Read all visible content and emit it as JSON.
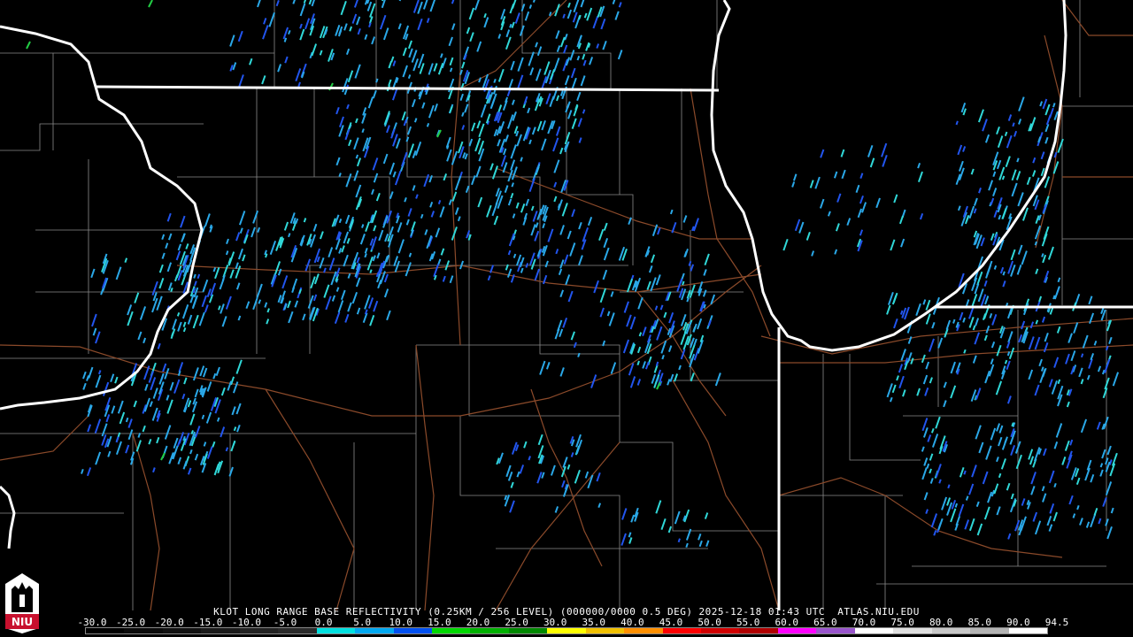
{
  "radar": {
    "station": "KLOT",
    "product": "LONG RANGE BASE REFLECTIVITY",
    "caption": "KLOT LONG RANGE BASE REFLECTIVITY (0.25KM / 256 LEVEL) (000000/0000 0.5 DEG) 2025-12-18 01:43 UTC  ATLAS.NIU.EDU"
  },
  "legend": {
    "labels": [
      "-30.0",
      "-25.0",
      "-20.0",
      "-15.0",
      "-10.0",
      "-5.0",
      "0.0",
      "5.0",
      "10.0",
      "15.0",
      "20.0",
      "25.0",
      "30.0",
      "35.0",
      "40.0",
      "45.0",
      "50.0",
      "55.0",
      "60.0",
      "65.0",
      "70.0",
      "75.0",
      "80.0",
      "85.0",
      "90.0",
      "94.5"
    ],
    "colors": [
      "#000000",
      "#0a0a0a",
      "#111111",
      "#1a1a1a",
      "#222222",
      "#2a2a2a",
      "#00e0e0",
      "#00a8f0",
      "#0050f0",
      "#00d800",
      "#00b000",
      "#008800",
      "#ffff00",
      "#f0c000",
      "#ff9000",
      "#ff0000",
      "#d00000",
      "#b00000",
      "#ff00ff",
      "#9955cc",
      "#ffffff",
      "#e0e0e0",
      "#c8c8c8",
      "#b4b4b4",
      "#ffffff"
    ]
  },
  "logo": {
    "text": "NIU",
    "icon": "university-logo-icon"
  },
  "colors": {
    "state_border": "#ffffff",
    "county_line": "#8a8a8a",
    "road": "#8b4a2a",
    "light_echo": "#2aa8e8",
    "cyan_echo": "#30d8d8",
    "blue_echo": "#2255ee",
    "green_echo": "#22cc44"
  }
}
